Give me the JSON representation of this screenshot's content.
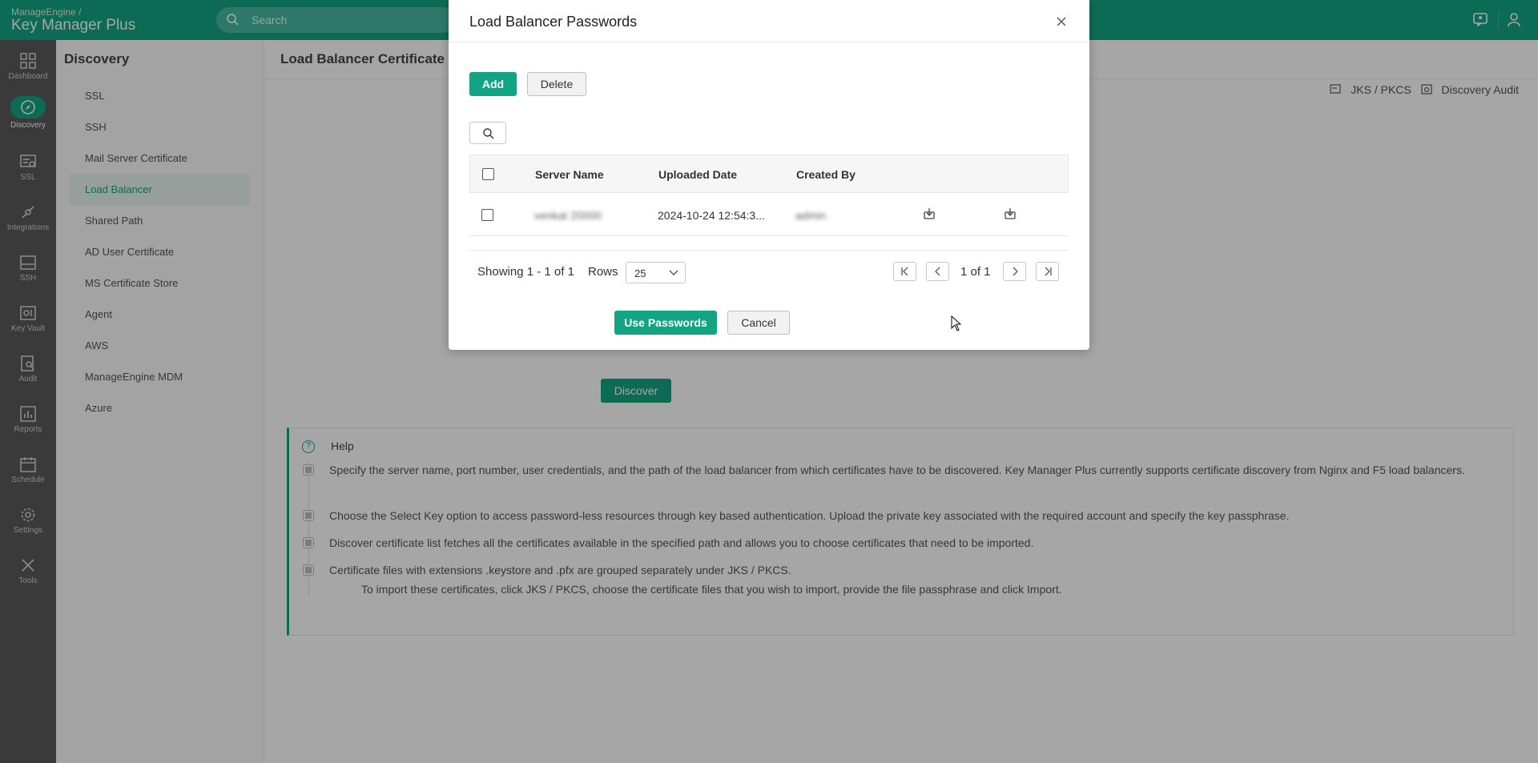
{
  "brand": {
    "line1": "ManageEngine /",
    "line2": "Key Manager Plus"
  },
  "search": {
    "placeholder": "Search"
  },
  "leftnav": [
    {
      "label": "Dashboard",
      "icon": "dashboard-icon"
    },
    {
      "label": "Discovery",
      "icon": "compass-icon",
      "active": true
    },
    {
      "label": "SSL",
      "icon": "ssl-certificate-icon"
    },
    {
      "label": "Integrations",
      "icon": "integrations-icon"
    },
    {
      "label": "SSH",
      "icon": "ssh-icon"
    },
    {
      "label": "Key Vault",
      "icon": "key-vault-icon"
    },
    {
      "label": "Audit",
      "icon": "audit-icon"
    },
    {
      "label": "Reports",
      "icon": "reports-icon"
    },
    {
      "label": "Schedule",
      "icon": "calendar-icon"
    },
    {
      "label": "Settings",
      "icon": "gear-icon"
    },
    {
      "label": "Tools",
      "icon": "tools-icon"
    }
  ],
  "subnav": {
    "title": "Discovery",
    "items": [
      {
        "label": "SSL"
      },
      {
        "label": "SSH"
      },
      {
        "label": "Mail Server Certificate"
      },
      {
        "label": "Load Balancer",
        "active": true
      },
      {
        "label": "Shared Path"
      },
      {
        "label": "AD User Certificate"
      },
      {
        "label": "MS Certificate Store"
      },
      {
        "label": "Agent"
      },
      {
        "label": "AWS"
      },
      {
        "label": "ManageEngine MDM"
      },
      {
        "label": "Azure"
      }
    ]
  },
  "main": {
    "title": "Load Balancer Certificate",
    "links": {
      "jks": "JKS / PKCS",
      "audit": "Discovery Audit"
    },
    "discover_label": "Discover",
    "help": {
      "title": "Help",
      "items": [
        "Specify the server name, port number, user credentials, and the path of the load balancer from which certificates have to be discovered. Key Manager Plus currently supports certificate discovery from Nginx and F5 load balancers.",
        "Choose the Select Key option to access password-less resources through key based authentication. Upload the private key associated with the required account and specify the key passphrase.",
        "Discover certificate list fetches all the certificates available in the specified path and allows you to choose certificates that need to be imported.",
        "Certificate files with extensions .keystore and .pfx are grouped separately under JKS / PKCS."
      ],
      "sub": "To import these certificates, click JKS / PKCS, choose the certificate files that you wish to import, provide the file passphrase and click Import."
    }
  },
  "modal": {
    "title": "Load Balancer Passwords",
    "add_label": "Add",
    "delete_label": "Delete",
    "columns": [
      "Server Name",
      "Uploaded Date",
      "Created By"
    ],
    "rows": [
      {
        "server": "venkat 20000",
        "date": "2024-10-24 12:54:3...",
        "created_by": "admin"
      }
    ],
    "showing": "Showing 1 - 1 of 1",
    "rows_label": "Rows",
    "rows_value": "25",
    "page_text": "1 of 1",
    "use_label": "Use Passwords",
    "cancel_label": "Cancel"
  },
  "colors": {
    "accent": "#13a583",
    "nav_bg": "#5a5a5a"
  }
}
